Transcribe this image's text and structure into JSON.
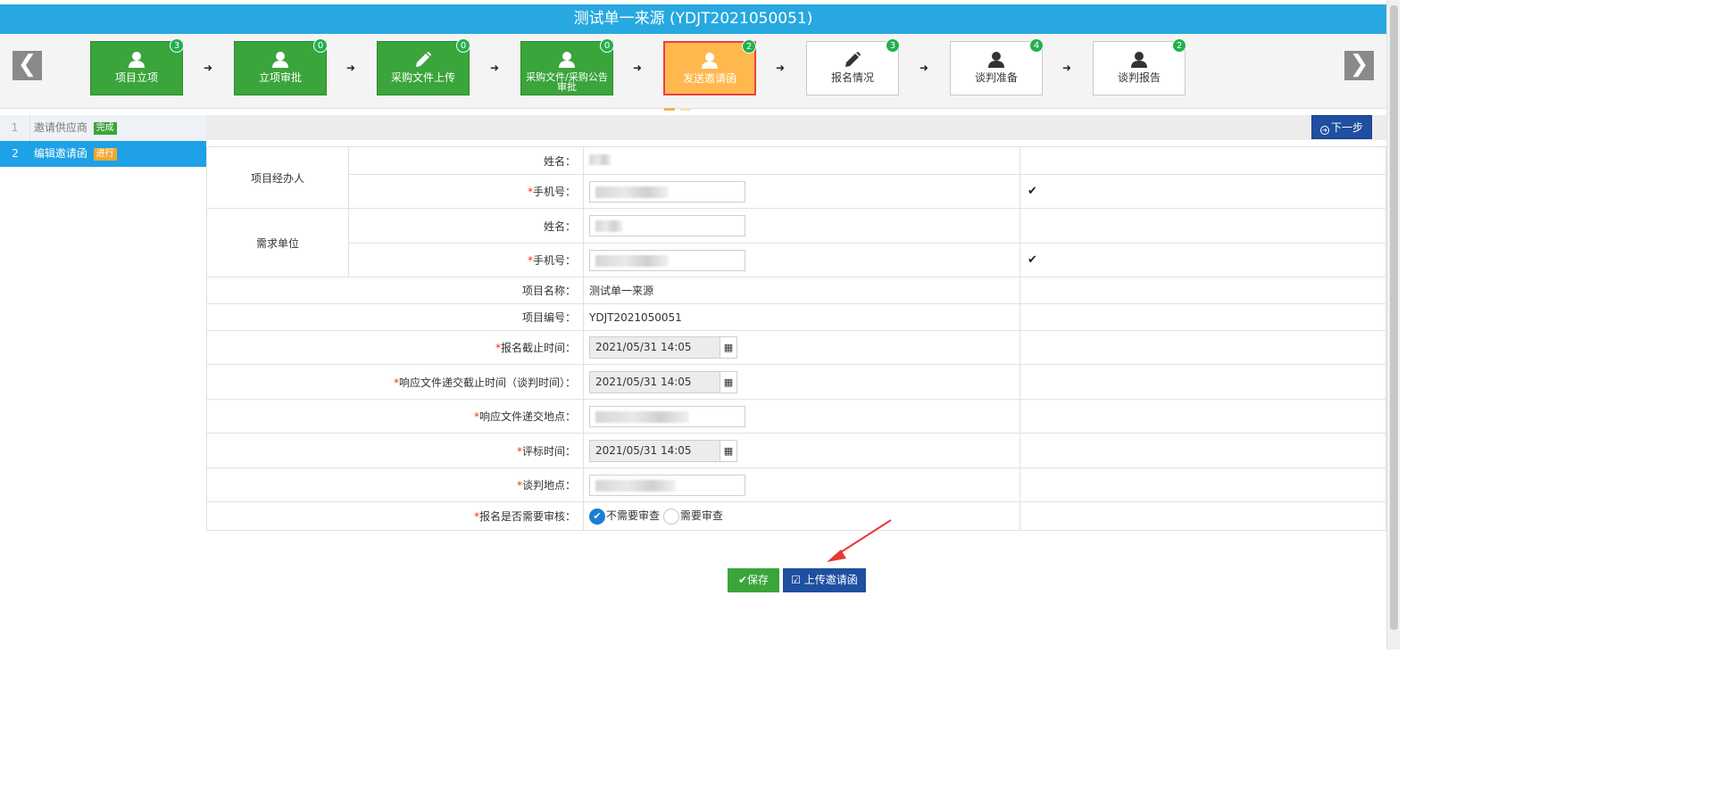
{
  "title": "测试单一来源 (YDJT2021050051)",
  "steps": [
    {
      "label": "项目立项",
      "count": "3",
      "icon": "user-icon",
      "state": "done"
    },
    {
      "label": "立项审批",
      "count": "0",
      "icon": "user-icon",
      "state": "done"
    },
    {
      "label": "采购文件上传",
      "count": "0",
      "icon": "pencil-icon",
      "state": "done"
    },
    {
      "label": "采购文件/采购公告审批",
      "count": "0",
      "icon": "user-icon",
      "state": "done"
    },
    {
      "label": "发送邀请函",
      "count": "2",
      "icon": "user-icon",
      "state": "active"
    },
    {
      "label": "报名情况",
      "count": "3",
      "icon": "pencil-icon",
      "state": "todo"
    },
    {
      "label": "谈判准备",
      "count": "4",
      "icon": "user-icon",
      "state": "todo"
    },
    {
      "label": "谈判报告",
      "count": "2",
      "icon": "user-icon",
      "state": "todo"
    }
  ],
  "nav": {
    "prev": "❮",
    "next": "❯",
    "arrow": "➜"
  },
  "sidebar": [
    {
      "num": "1",
      "label": "邀请供应商",
      "tag": "完成"
    },
    {
      "num": "2",
      "label": "编辑邀请函",
      "tag": "进行"
    }
  ],
  "toolbar": {
    "next_label": "下一步"
  },
  "form": {
    "manager_group": "项目经办人",
    "demand_group": "需求单位",
    "name_label": "姓名：",
    "phone_label": "手机号：",
    "project_name_label": "项目名称：",
    "project_name": "测试单一来源",
    "project_no_label": "项目编号：",
    "project_no": "YDJT2021050051",
    "signup_deadline_label": "报名截止时间：",
    "signup_deadline": "2021/05/31 14:05",
    "response_deadline_label": "响应文件递交截止时间（谈判时间）：",
    "response_deadline": "2021/05/31 14:05",
    "response_place_label": "响应文件递交地点：",
    "eval_time_label": "评标时间：",
    "eval_time": "2021/05/31 14:05",
    "negotiation_place_label": "谈判地点：",
    "review_label": "报名是否需要审核：",
    "review_options": [
      "不需要审查",
      "需要审查"
    ],
    "review_selected": "不需要审查",
    "required_mark": "*",
    "check_mark": "✔",
    "calendar_glyph": "▦"
  },
  "buttons": {
    "save": "保存",
    "upload": "上传邀请函"
  },
  "colors": {
    "titlebar": "#27a8e0",
    "done": "#3aa53a",
    "active": "#ffb84d",
    "primary": "#1f4fa0",
    "annotation": "#e53935"
  }
}
